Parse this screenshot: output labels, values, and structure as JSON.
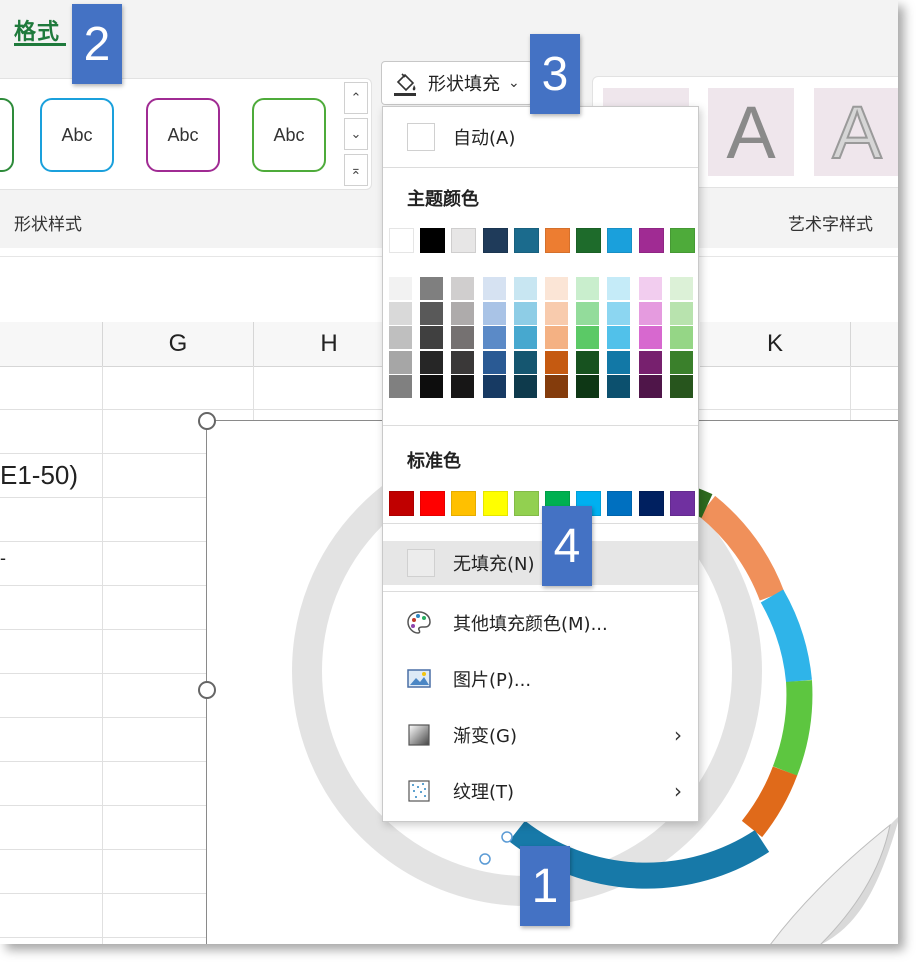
{
  "ribbon": {
    "tab_format": "格式",
    "shape_styles_label": "形状样式",
    "wordart_styles_label": "艺术字样式",
    "abc": [
      "Abc",
      "Abc",
      "Abc"
    ],
    "fill_button_label": "形状填充",
    "wordart_letter": "A"
  },
  "sheet": {
    "columns": [
      "G",
      "H",
      "K"
    ],
    "cell_text_1": "E1-50)",
    "cell_text_2": "-"
  },
  "menu": {
    "auto_label": "自动(A)",
    "theme_colors_heading": "主题颜色",
    "standard_colors_heading": "标准色",
    "no_fill_label": "无填充(N)",
    "more_colors_label": "其他填充颜色(M)...",
    "picture_label": "图片(P)...",
    "gradient_label": "渐变(G)",
    "texture_label": "纹理(T)",
    "theme_colors": [
      "#ffffff",
      "#000000",
      "#e7e6e6",
      "#1f3b5a",
      "#1b6b8d",
      "#ed7d31",
      "#1e6b2b",
      "#1aa0dc",
      "#a02b93",
      "#4eab3a"
    ],
    "theme_shades": [
      [
        "#f2f2f2",
        "#d9d9d9",
        "#bfbfbf",
        "#a6a6a6",
        "#808080"
      ],
      [
        "#7f7f7f",
        "#595959",
        "#404040",
        "#262626",
        "#0d0d0d"
      ],
      [
        "#d0cece",
        "#aeabab",
        "#757171",
        "#3a3838",
        "#171616"
      ],
      [
        "#d6e2f2",
        "#a9c3e6",
        "#5b8ac7",
        "#2a5a94",
        "#173a63"
      ],
      [
        "#c8e6f2",
        "#8ecde6",
        "#47a8cf",
        "#155670",
        "#0e3a4c"
      ],
      [
        "#fbe5d6",
        "#f8cbad",
        "#f4b183",
        "#c55a11",
        "#843c0c"
      ],
      [
        "#c9eecd",
        "#93dc9b",
        "#5bc966",
        "#17521f",
        "#0e3715"
      ],
      [
        "#c5ebf8",
        "#8cd6f1",
        "#51c1ea",
        "#1278a6",
        "#0c506e"
      ],
      [
        "#f2cdef",
        "#e59bdf",
        "#d768cf",
        "#77206e",
        "#4f1549"
      ],
      [
        "#dcf1d7",
        "#b8e3ae",
        "#95d686",
        "#3a802b",
        "#27551d"
      ]
    ],
    "standard_colors": [
      "#c00000",
      "#ff0000",
      "#ffc000",
      "#ffff00",
      "#92d050",
      "#00b050",
      "#00b0f0",
      "#0070c0",
      "#002060",
      "#7030a0"
    ]
  },
  "badges": [
    "1",
    "2",
    "3",
    "4"
  ],
  "chart_ring_colors": [
    "#2e6b1f",
    "#f0905a",
    "#2fb4e9",
    "#5dc640",
    "#e06a1a",
    "#1779a8"
  ]
}
